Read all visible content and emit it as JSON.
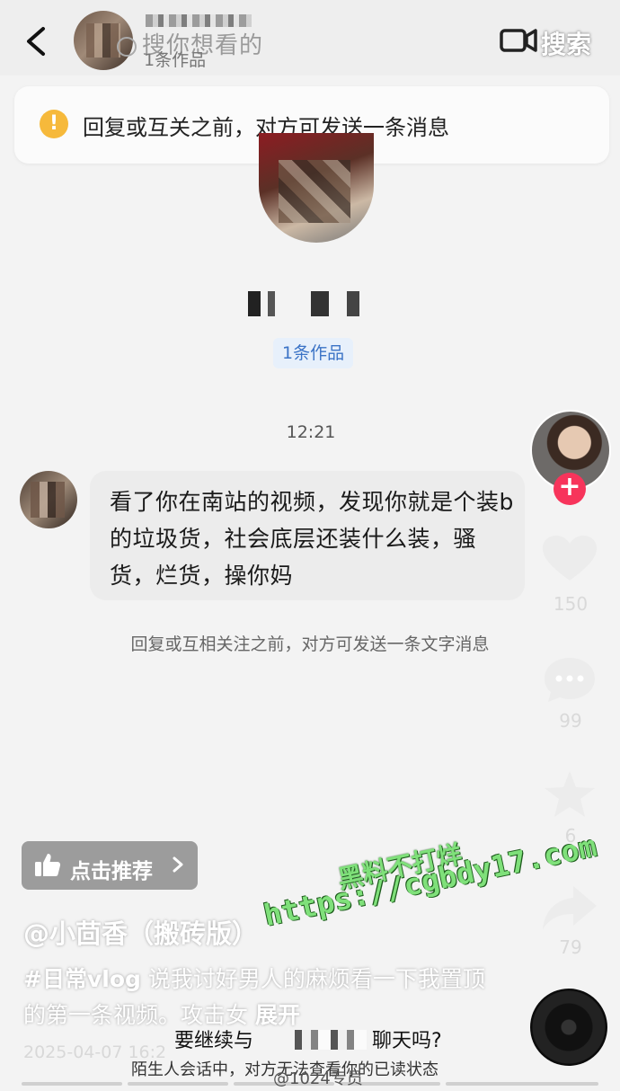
{
  "header": {
    "search_placeholder": "搜你想看的",
    "works_count": "1条作品",
    "search_button": "搜索"
  },
  "notice": {
    "text": "回复或互关之前，对方可发送一条消息"
  },
  "profile": {
    "works_chip": "1条作品"
  },
  "chat": {
    "time": "12:21",
    "message": "看了你在南站的视频，发现你就是个装b的垃圾货，社会底层还装什么装，骚货，烂货，操你妈",
    "limit_hint": "回复或互相关注之前，对方可发送一条文字消息"
  },
  "rail": {
    "likes": "150",
    "comments": "99",
    "favorites": "6",
    "shares": "79"
  },
  "video": {
    "recommend_label": "点击推荐",
    "author": "@小茴香（搬砖版）",
    "hashtag": "#日常vlog",
    "description": " 说我讨好男人的麻烦看一下我置顶的第一条视频。攻击女",
    "expand": "展开",
    "datetime": "2025-04-07 16:2",
    "continue_prompt_a": "要继续与",
    "continue_prompt_b": "聊天吗?",
    "stranger_note": "陌生人会话中，对方无法查看你的已读状态"
  },
  "watermark": {
    "line1": "黑料不打烊",
    "line2": "https://cgbdy17.com",
    "weibo": "@1024专员"
  },
  "colors": {
    "accent_red": "#f7345b",
    "link_blue": "#3b73c6",
    "warning": "#f6b93b",
    "watermark_green": "#7fe07a"
  }
}
